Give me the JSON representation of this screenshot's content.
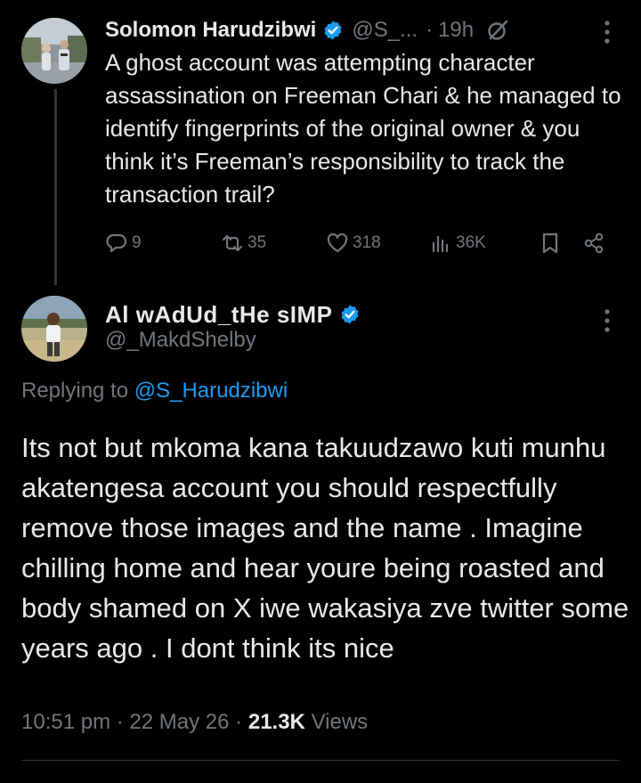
{
  "parent_tweet": {
    "author_name": "Solomon Harudzibwi",
    "handle": "@S_...",
    "separator": "·",
    "time": "19h",
    "text": "A ghost account was attempting character assassination on Freeman Chari & he managed to identify fingerprints of the original owner & you think it’s Freeman’s responsibility to track the transaction trail?",
    "replies": "9",
    "reposts": "35",
    "likes": "318",
    "views": "36K"
  },
  "reply_tweet": {
    "author_name": "Al wAdUd_tHe sIMP",
    "handle": "@_MakdShelby",
    "replying_prefix": "Replying to",
    "replying_to": "@S_Harudzibwi",
    "text": "Its not but mkoma kana takuudzawo kuti munhu akatengesa account you should respectfully remove those images and the name . Imagine chilling home and hear youre being roasted and body shamed on X iwe wakasiya zve twitter some years ago . I dont think its nice",
    "time": "10:51 pm",
    "date": "22 May 26",
    "views_count": "21.3K",
    "views_label": "Views",
    "dot": "·"
  },
  "colors": {
    "background": "#000000",
    "text": "#e7e9ea",
    "secondary": "#71767b",
    "accent": "#1d9bf0",
    "thread_line": "#333639"
  },
  "icons": [
    "verified-badge-icon",
    "grok-icon",
    "more-options-icon",
    "reply-icon",
    "repost-icon",
    "like-icon",
    "views-icon",
    "bookmark-icon",
    "share-icon"
  ]
}
